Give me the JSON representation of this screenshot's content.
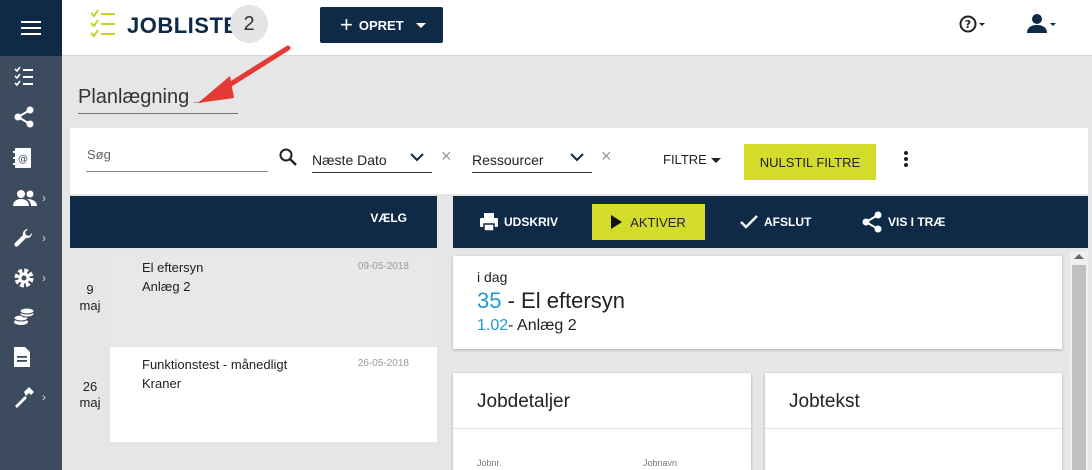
{
  "app": {
    "title": "JOBLISTE",
    "count": "2"
  },
  "toolbar": {
    "create_label": "OPRET"
  },
  "planning": {
    "label": "Planlægning",
    "ellipsis": "..."
  },
  "filters": {
    "search_placeholder": "Søg",
    "next_date": "Næste Dato",
    "resources": "Ressourcer",
    "filters_label": "FILTRE",
    "reset_label": "NULSTIL FILTRE"
  },
  "list": {
    "select_label": "VÆLG",
    "items": [
      {
        "day": "9",
        "month": "maj",
        "title": "El eftersyn",
        "subtitle": "Anlæg 2",
        "date": "09-05-2018"
      },
      {
        "day": "26",
        "month": "maj",
        "title": "Funktionstest - månedligt",
        "subtitle": "Kraner",
        "date": "26-05-2018"
      }
    ]
  },
  "actions": {
    "print": "UDSKRIV",
    "activate": "AKTIVER",
    "finish": "AFSLUT",
    "show_tree": "VIS I TRÆ"
  },
  "today": {
    "label": "i dag",
    "job_number": "35",
    "job_name": "- El eftersyn",
    "plant_number": "1.02",
    "plant_name": "- Anlæg 2"
  },
  "details": {
    "job_details_title": "Jobdetaljer",
    "job_text_title": "Jobtekst",
    "job_no_label": "Jobnr.",
    "job_name_label": "Jobnavn"
  },
  "colors": {
    "navy": "#0e2a47",
    "sidebar": "#3d4b5e",
    "accent": "#d3dc2b",
    "link_blue": "#1e9bd7",
    "annotation": "#e53935"
  }
}
